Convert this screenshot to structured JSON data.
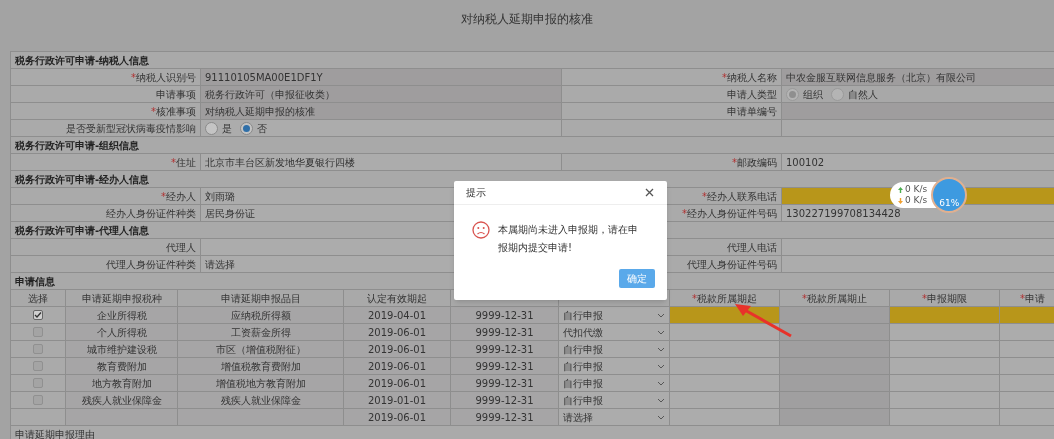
{
  "title": "对纳税人延期申报的核准",
  "sections": [
    {
      "title": "税务行政许可申请-纳税人信息",
      "rows": [
        {
          "left": {
            "label": "纳税人识别号",
            "marker": "*",
            "kind": "text",
            "value": "91110105MA00E1DF1Y",
            "readonly": true
          },
          "right": {
            "label": "纳税人名称",
            "marker": "*",
            "kind": "text",
            "value": "中农金服互联网信息服务（北京）有限公司",
            "readonly": true
          }
        },
        {
          "left": {
            "label": "申请事项",
            "kind": "text",
            "value": "税务行政许可（申报征收类）",
            "readonly": true
          },
          "right": {
            "label": "申请人类型",
            "kind": "radio",
            "disabled": true,
            "options": [
              {
                "label": "组织",
                "selected": true
              },
              {
                "label": "自然人",
                "selected": false
              }
            ]
          }
        },
        {
          "left": {
            "label": "核准事项",
            "marker": "*",
            "kind": "text",
            "value": "对纳税人延期申报的核准",
            "readonly": true
          },
          "right": {
            "label": "申请单编号",
            "kind": "text",
            "readonly": true
          }
        },
        {
          "left": {
            "label": "是否受新型冠状病毒疫情影响",
            "kind": "radio",
            "disabled": false,
            "options": [
              {
                "label": "是",
                "selected": false
              },
              {
                "label": "否",
                "selected": true
              }
            ]
          }
        }
      ]
    },
    {
      "title": "税务行政许可申请-组织信息",
      "rows": [
        {
          "left": {
            "label": "住址",
            "marker": "*",
            "kind": "text",
            "value": "北京市丰台区新发地华夏银行四楼",
            "readonly": false
          },
          "right": {
            "label": "邮政编码",
            "marker": "*",
            "kind": "text",
            "value": "100102",
            "readonly": false
          }
        }
      ]
    },
    {
      "title": "税务行政许可申请-经办人信息",
      "rows": [
        {
          "left": {
            "label": "经办人",
            "marker": "*",
            "kind": "text",
            "value": "刘雨璐",
            "readonly": false
          },
          "right": {
            "label": "经办人联系电话",
            "marker": "*",
            "kind": "text",
            "readonly": false,
            "highlighted": true
          }
        },
        {
          "left": {
            "label": "经办人身份证件种类",
            "kind": "text",
            "value": "居民身份证",
            "readonly": false
          },
          "right": {
            "label": "经办人身份证件号码",
            "marker": "*",
            "kind": "text",
            "value": "130227199708134428",
            "readonly": false
          }
        }
      ]
    },
    {
      "title": "税务行政许可申请-代理人信息",
      "rows": [
        {
          "left": {
            "label": "代理人",
            "kind": "text",
            "readonly": false
          },
          "right": {
            "label": "代理人电话",
            "kind": "text",
            "readonly": false
          }
        },
        {
          "left": {
            "label": "代理人身份证件种类",
            "kind": "text",
            "value": "请选择",
            "readonly": false
          },
          "right": {
            "label": "代理人身份证件号码",
            "kind": "text",
            "readonly": false
          }
        }
      ]
    }
  ],
  "application": {
    "title": "申请信息",
    "columns": [
      {
        "label": "选择"
      },
      {
        "label": "申请延期申报税种"
      },
      {
        "label": "申请延期申报品目"
      },
      {
        "label": "认定有效期起"
      },
      {},
      {},
      {
        "label": "税款所属期起",
        "marker": "*"
      },
      {
        "label": "税款所属期止",
        "marker": "*"
      },
      {
        "label": "申报期限",
        "marker": "*"
      },
      {
        "label": "申请",
        "marker": "*"
      }
    ],
    "rows": [
      {
        "checked": true,
        "tax": "企业所得税",
        "item": "应纳税所得额",
        "start": "2019-04-01",
        "end": "9999-12-31",
        "method": "自行申报",
        "extra": [
          {
            "highlighted": true
          },
          {
            "highlighted": false
          },
          {
            "highlighted": true
          },
          {
            "highlighted": true
          }
        ]
      },
      {
        "checked": false,
        "tax": "个人所得税",
        "item": "工资薪金所得",
        "start": "2019-06-01",
        "end": "9999-12-31",
        "method": "代扣代缴",
        "extra": [
          {
            "highlighted": false
          },
          {
            "highlighted": false
          },
          {
            "highlighted": false
          },
          {
            "highlighted": false
          }
        ]
      },
      {
        "checked": false,
        "tax": "城市维护建设税",
        "item": "市区（增值税附征）",
        "start": "2019-06-01",
        "end": "9999-12-31",
        "method": "自行申报",
        "extra": [
          {
            "highlighted": false
          },
          {
            "highlighted": false
          },
          {
            "highlighted": false
          },
          {
            "highlighted": false
          }
        ]
      },
      {
        "checked": false,
        "tax": "教育费附加",
        "item": "增值税教育费附加",
        "start": "2019-06-01",
        "end": "9999-12-31",
        "method": "自行申报",
        "extra": [
          {
            "highlighted": false
          },
          {
            "highlighted": false
          },
          {
            "highlighted": false
          },
          {
            "highlighted": false
          }
        ]
      },
      {
        "checked": false,
        "tax": "地方教育附加",
        "item": "增值税地方教育附加",
        "start": "2019-06-01",
        "end": "9999-12-31",
        "method": "自行申报",
        "extra": [
          {
            "highlighted": false
          },
          {
            "highlighted": false
          },
          {
            "highlighted": false
          },
          {
            "highlighted": false
          }
        ]
      },
      {
        "checked": false,
        "tax": "残疾人就业保障金",
        "item": "残疾人就业保障金",
        "start": "2019-01-01",
        "end": "9999-12-31",
        "method": "自行申报",
        "extra": [
          {
            "highlighted": false
          },
          {
            "highlighted": false
          },
          {
            "highlighted": false
          },
          {
            "highlighted": false
          }
        ]
      },
      {
        "start": "2019-06-01",
        "end": "9999-12-31",
        "method": "请选择",
        "extra": [
          {
            "highlighted": false
          },
          {
            "highlighted": false
          },
          {
            "highlighted": false
          },
          {
            "highlighted": false
          }
        ]
      }
    ],
    "reason_label": "申请延期申报理由"
  },
  "dialog": {
    "title": "提示",
    "message": "本属期尚未进入申报期，请在申报期内提交申请!",
    "confirm": "确定"
  },
  "speed_widget": {
    "upload": "0 K/s",
    "download": "0 K/s",
    "percent": "61%"
  }
}
